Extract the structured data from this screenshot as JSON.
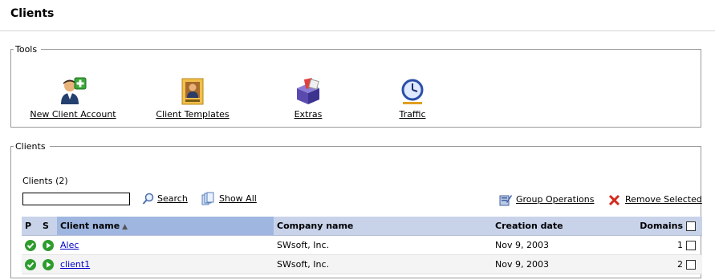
{
  "page": {
    "title": "Clients"
  },
  "tools": {
    "legend": "Tools",
    "items": [
      {
        "label": "New Client Account",
        "icon": "new-client-icon"
      },
      {
        "label": "Client Templates",
        "icon": "client-templates-icon"
      },
      {
        "label": "Extras",
        "icon": "extras-icon"
      },
      {
        "label": "Traffic",
        "icon": "traffic-icon"
      }
    ]
  },
  "clients": {
    "legend": "Clients",
    "count_label": "Clients (2)",
    "search": {
      "value": "",
      "button_label": "Search"
    },
    "show_all_label": "Show All",
    "group_operations_label": "Group Operations",
    "remove_selected_label": "Remove Selected",
    "columns": {
      "p": "P",
      "s": "S",
      "client_name": "Client name",
      "company_name": "Company name",
      "creation_date": "Creation date",
      "domains": "Domains"
    },
    "rows": [
      {
        "client_name": "Alec",
        "company_name": "SWsoft, Inc.",
        "creation_date": "Nov 9, 2003",
        "domains": "1"
      },
      {
        "client_name": "client1",
        "company_name": "SWsoft, Inc.",
        "creation_date": "Nov 9, 2003",
        "domains": "2"
      }
    ]
  },
  "colors": {
    "header_bg": "#c8d3ea",
    "sorted_header_bg": "#9fb6e0",
    "status_green": "#2e9c2e",
    "link": "#0000cc"
  }
}
